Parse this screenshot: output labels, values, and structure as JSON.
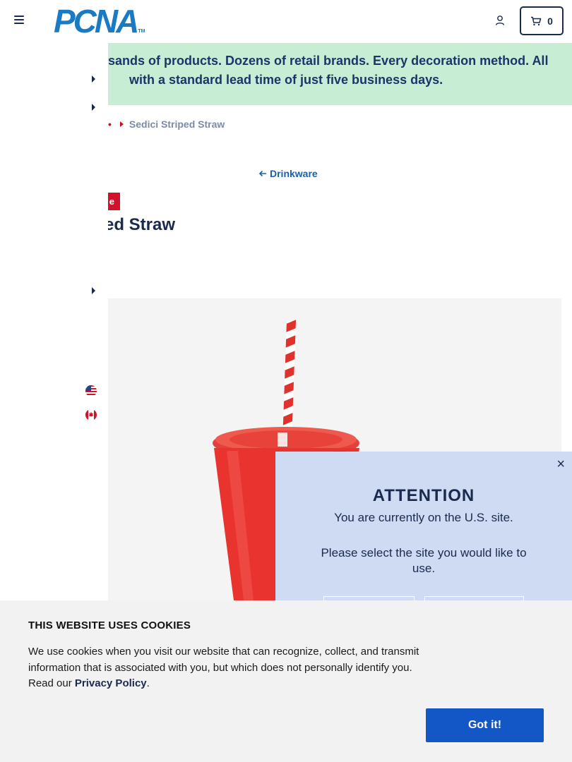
{
  "header": {
    "logo_text": "PCNA",
    "logo_tm": "TM",
    "cart_count": "0",
    "icons": [
      "menu-icon",
      "user-icon",
      "cart-icon"
    ]
  },
  "banner": {
    "line1": "usands of products. Dozens of retail brands. Every decoration method. All",
    "line2": "with a standard lead time of just five business days.",
    "bg_color": "#c7eed5"
  },
  "breadcrumb": {
    "separator_text": "•",
    "current": "Sedici Striped Straw"
  },
  "back_link": {
    "label": "Drinkware"
  },
  "product": {
    "badge": "e",
    "title": "ed Straw",
    "cup_color": "#e8332f"
  },
  "attention_modal": {
    "close": "×",
    "title": "ATTENTION",
    "line1": "You are currently on the U.S. site.",
    "line2": "Please select the site you would like to use.",
    "bg_color": "#cfdbf2"
  },
  "cookie_banner": {
    "title": "THIS WEBSITE USES COOKIES",
    "text": "We use cookies when you visit our website that can recognize, collect, and transmit information that is associated with you, but which does not personally identify you. Read our",
    "link": "Privacy Policy",
    "period": ".",
    "button": "Got it!",
    "button_color": "#1357c6"
  }
}
